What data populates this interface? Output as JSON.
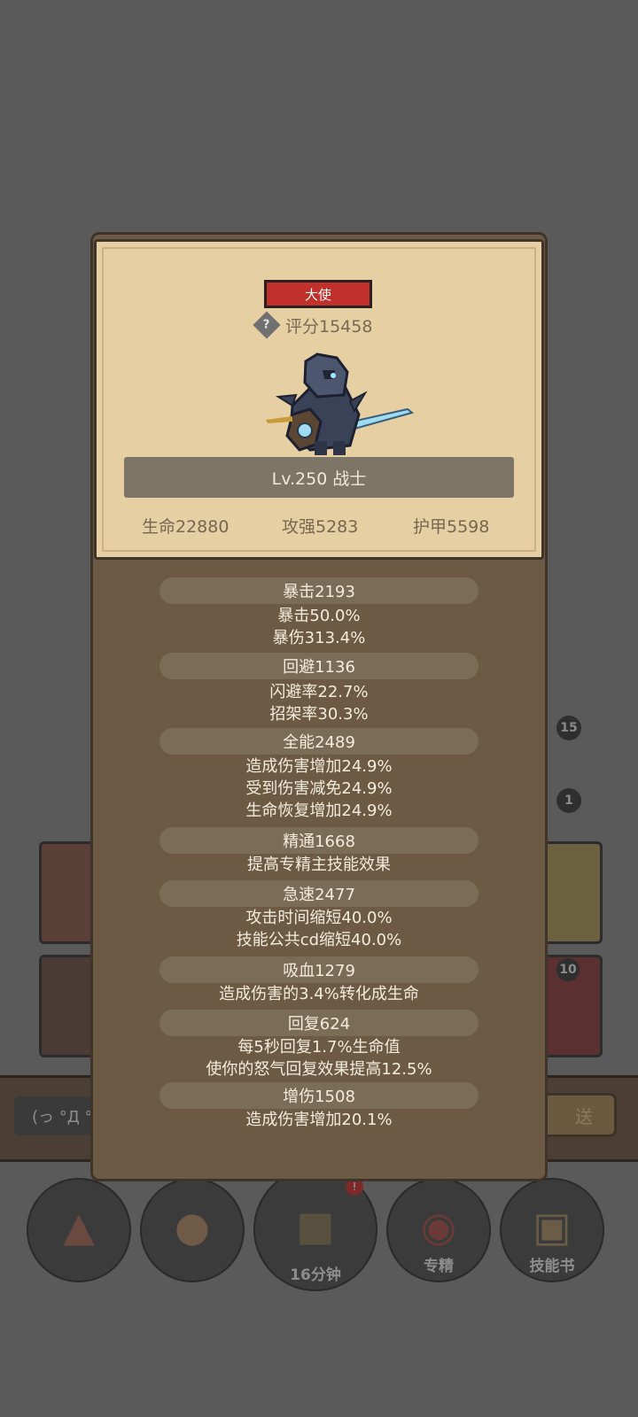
{
  "background": {
    "badge_top": "15",
    "badge_second": "1",
    "badge_card": "10",
    "chat_input_text": "(っ °Д °",
    "send_label": "送",
    "bottom_nav": {
      "chest_timer": "16分钟",
      "specialize_label": "专精",
      "skillbook_label": "技能书"
    }
  },
  "character": {
    "title_badge": "大使",
    "score": "评分15458",
    "level_class": "Lv.250 战士",
    "hp": "生命22880",
    "attack": "攻强5283",
    "armor": "护甲5598"
  },
  "stats": [
    {
      "header": "暴击2193",
      "lines": [
        "暴击50.0%",
        "暴伤313.4%"
      ]
    },
    {
      "header": "回避1136",
      "lines": [
        "闪避率22.7%",
        "招架率30.3%"
      ]
    },
    {
      "header": "全能2489",
      "lines": [
        "造成伤害增加24.9%",
        "受到伤害减免24.9%",
        "生命恢复增加24.9%"
      ]
    },
    {
      "header": "精通1668",
      "lines": [
        "提高专精主技能效果"
      ]
    },
    {
      "header": "急速2477",
      "lines": [
        "攻击时间缩短40.0%",
        "技能公共cd缩短40.0%"
      ]
    },
    {
      "header": "吸血1279",
      "lines": [
        "造成伤害的3.4%转化成生命"
      ]
    },
    {
      "header": "回复624",
      "lines": [
        "每5秒回复1.7%生命值",
        "使你的怒气回复效果提高12.5%"
      ]
    },
    {
      "header": "增伤1508",
      "lines": [
        "造成伤害增加20.1%"
      ]
    }
  ],
  "colors": {
    "panel": "#6c5a44",
    "parchment": "#e6cfa3",
    "badge_red": "#c2302b",
    "pill": "#7b6c58"
  }
}
